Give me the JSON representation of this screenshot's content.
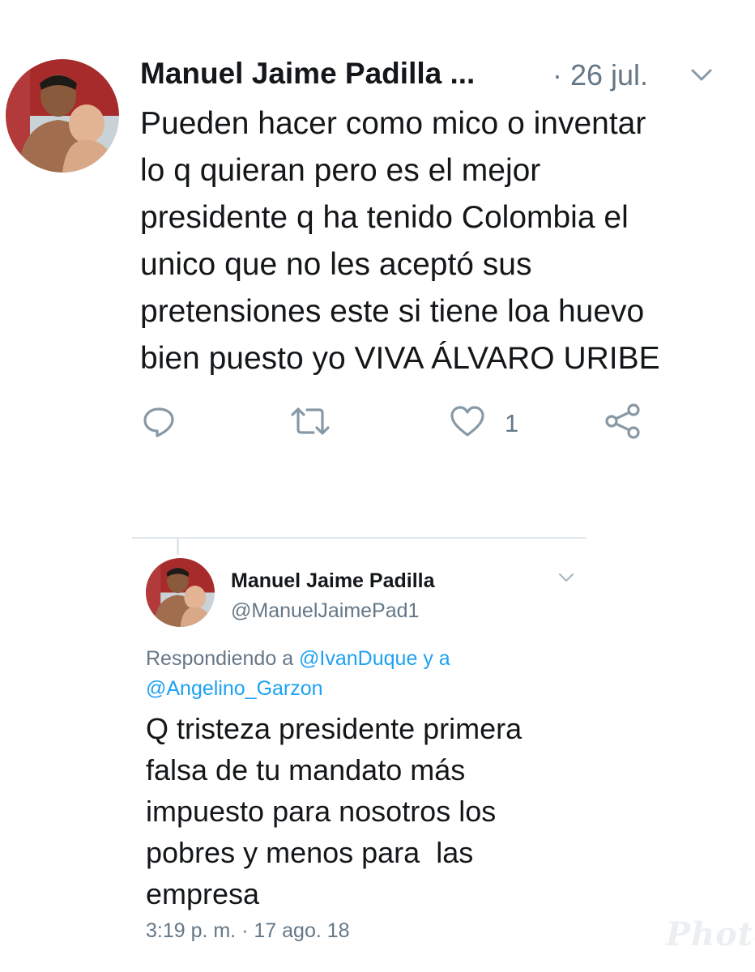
{
  "tweet": {
    "author_name": "Manuel Jaime Padilla ...",
    "date": "· 26 jul.",
    "text_lines": [
      "Pueden hacer como mico o inventar",
      "lo q quieran pero es el mejor",
      "presidente q ha tenido Colombia el",
      "unico que no les aceptó sus",
      "pretensiones este si tiene loa huevo",
      "bien puesto yo VIVA ÁLVARO URIBE"
    ],
    "like_count": "1",
    "icons": {
      "reply": "reply-icon",
      "retweet": "retweet-icon",
      "like": "heart-icon",
      "share": "share-icon",
      "menu": "chevron-down-icon"
    }
  },
  "quoted": {
    "author_name": "Manuel Jaime Padilla",
    "handle": "@ManuelJaimePad1",
    "reply_prefix": "Respondiendo a",
    "reply_user1": "@IvanDuque",
    "reply_and": "y a",
    "reply_user2": "@Angelino_Garzon",
    "text_lines": [
      "Q tristeza presidente primera",
      "falsa de tu mandato más",
      "impuesto para nosotros los",
      "pobres y menos para  las",
      "empresa"
    ],
    "timestamp": "3:19 p. m. · 17 ago. 18"
  },
  "watermark": "Photo",
  "colors": {
    "text": "#14171a",
    "secondary": "#657786",
    "icon": "#8899a6",
    "link": "#1da1f2",
    "divider": "#e1e8ed"
  }
}
